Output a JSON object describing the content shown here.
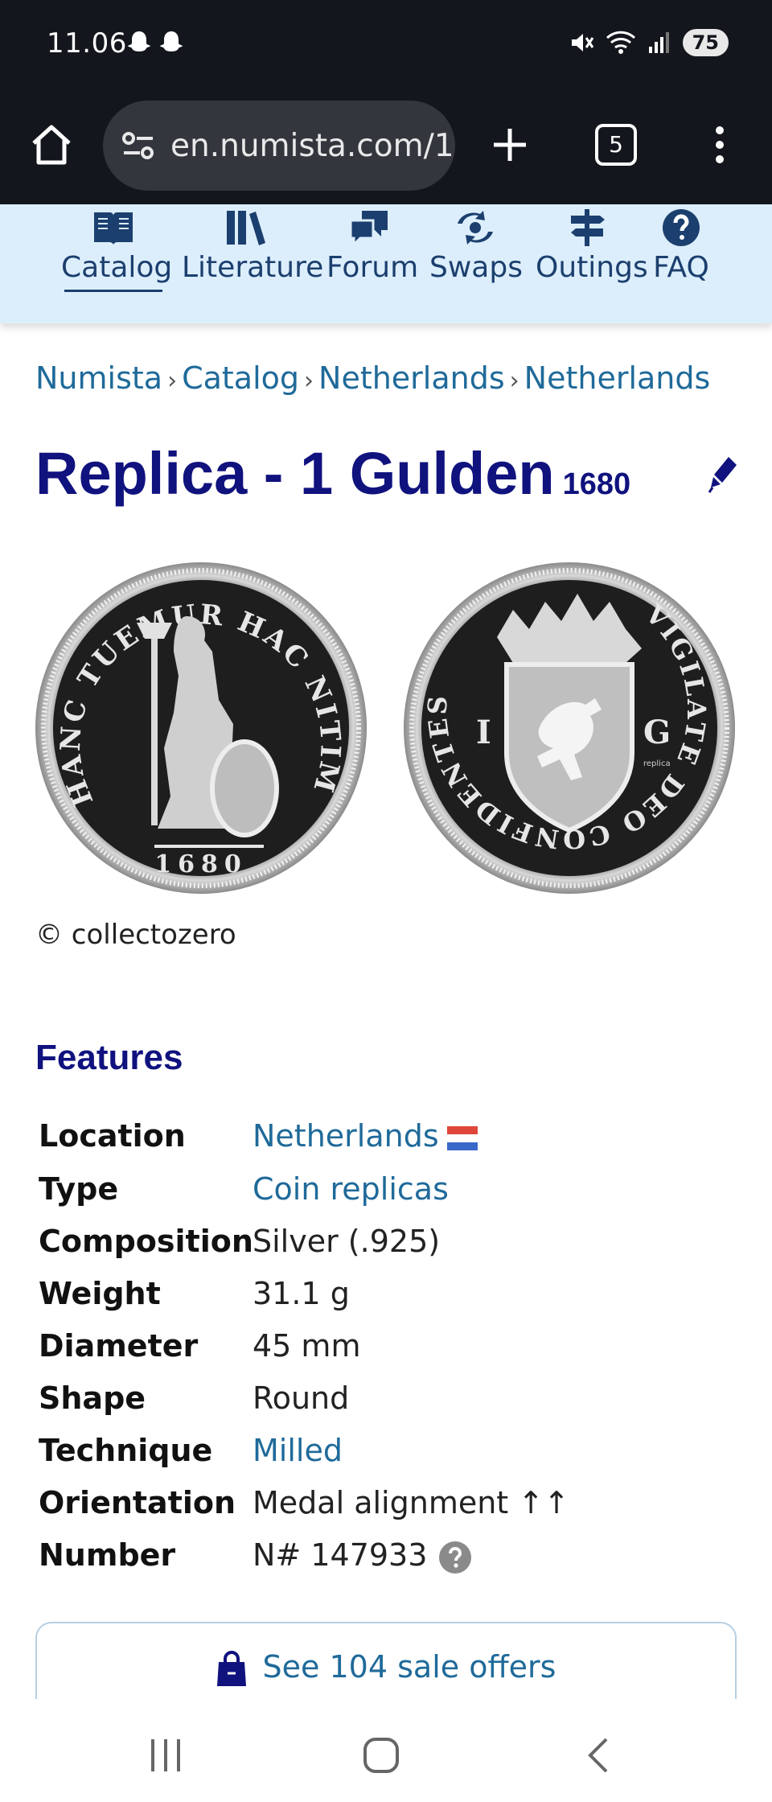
{
  "status_bar": {
    "time": "11.06",
    "battery": "75"
  },
  "browser": {
    "url": "en.numista.com/1",
    "tab_count": "5"
  },
  "site_nav": {
    "items": [
      {
        "label": "Catalog",
        "icon": "book-open-icon",
        "active": true
      },
      {
        "label": "Literature",
        "icon": "books-icon",
        "active": false
      },
      {
        "label": "Forum",
        "icon": "chat-bubbles-icon",
        "active": false
      },
      {
        "label": "Swaps",
        "icon": "swap-arrows-icon",
        "active": false
      },
      {
        "label": "Outings",
        "icon": "signpost-icon",
        "active": false
      },
      {
        "label": "FAQ",
        "icon": "question-circle-icon",
        "active": false
      }
    ]
  },
  "breadcrumb": [
    "Numista",
    "Catalog",
    "Netherlands",
    "Netherlands"
  ],
  "title": {
    "main": "Replica - 1 Gulden",
    "year": "1680"
  },
  "coins": {
    "obverse_legend": "HANC TUEMUR HAC NITIMUR",
    "obverse_date": "1680",
    "reverse_legend": "VIGILATE DEO CONFIDENTES",
    "reverse_left": "I",
    "reverse_right": "G",
    "reverse_mark": "replica"
  },
  "copyright": "© collectozero",
  "features": {
    "title": "Features",
    "rows": [
      {
        "label": "Location",
        "value": "Netherlands",
        "link": true,
        "flag": true
      },
      {
        "label": "Type",
        "value": "Coin replicas",
        "link": true
      },
      {
        "label": "Composition",
        "value": "Silver (.925)",
        "link": false
      },
      {
        "label": "Weight",
        "value": "31.1 g",
        "link": false
      },
      {
        "label": "Diameter",
        "value": "45 mm",
        "link": false
      },
      {
        "label": "Shape",
        "value": "Round",
        "link": false
      },
      {
        "label": "Technique",
        "value": "Milled",
        "link": true
      },
      {
        "label": "Orientation",
        "value": "Medal alignment ↑↑",
        "link": false
      },
      {
        "label": "Number",
        "value": "N# 147933",
        "link": false,
        "help": true
      }
    ]
  },
  "sale_offers": {
    "label": "See 104 sale offers"
  },
  "colors": {
    "brand_navy": "#10127e",
    "link_blue": "#1f6a9a",
    "nav_bg": "#dceefb",
    "dark_bar": "#13161c"
  }
}
